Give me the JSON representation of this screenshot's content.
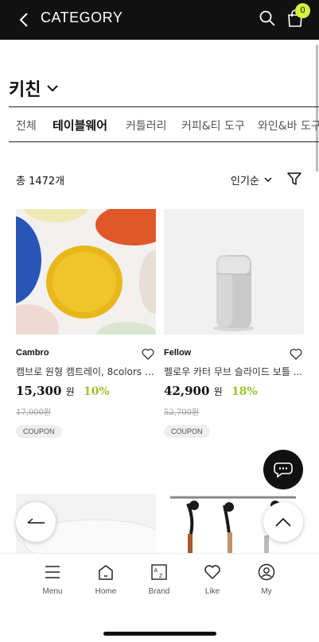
{
  "header": {
    "title": "CATEGORY",
    "cart_count": "0",
    "bg_color": "#111111",
    "badge_color": "#d6f03f"
  },
  "category": {
    "title": "키친"
  },
  "tabs": [
    {
      "label": "전체",
      "active": false
    },
    {
      "label": "테이블웨어",
      "active": true
    },
    {
      "label": "커틀러리",
      "active": false
    },
    {
      "label": "커피&티 도구",
      "active": false
    },
    {
      "label": "와인&바 도구",
      "active": false
    }
  ],
  "listing": {
    "count_text": "총 1472개",
    "sort_label": "인기순"
  },
  "products": [
    {
      "brand": "Cambro",
      "name": "캠브로 원형 캠트레이, 8colors (...",
      "price": "15,300",
      "currency": "원",
      "discount": "10%",
      "original_price": "17,000",
      "coupon": "COUPON"
    },
    {
      "brand": "Fellow",
      "name": "펠로우 카터 무브 슬라이드 보틀 ...",
      "price": "42,900",
      "currency": "원",
      "discount": "18%",
      "original_price": "52,700",
      "coupon": "COUPON"
    }
  ],
  "bottom_nav": [
    {
      "label": "Menu",
      "icon": "menu-icon"
    },
    {
      "label": "Home",
      "icon": "home-icon"
    },
    {
      "label": "Brand",
      "icon": "brand-az-icon"
    },
    {
      "label": "Like",
      "icon": "heart-icon"
    },
    {
      "label": "My",
      "icon": "user-icon"
    }
  ],
  "colors": {
    "accent_discount": "#9bc12b"
  }
}
